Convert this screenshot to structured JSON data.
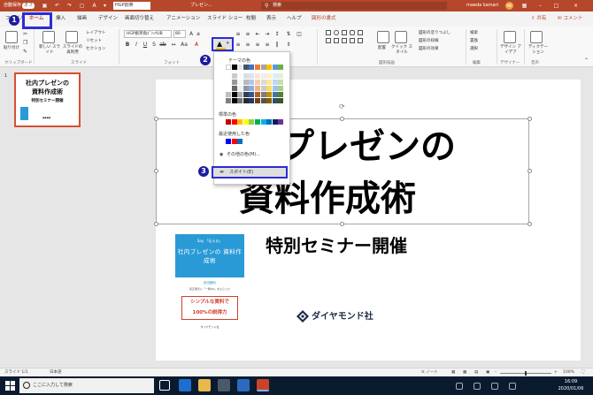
{
  "titlebar": {
    "autosave_label": "自動保存",
    "autosave_state": "オフ",
    "font_field": "HGP創英",
    "doc_title": "プレゼン...",
    "search_placeholder": "検索",
    "user_name": "maeda kamari",
    "user_initials": "MK"
  },
  "tabs": [
    {
      "label": "ファイル"
    },
    {
      "label": "ホーム",
      "active": true
    },
    {
      "label": "挿入"
    },
    {
      "label": "描画"
    },
    {
      "label": "デザイン"
    },
    {
      "label": "画面切り替え"
    },
    {
      "label": "アニメーション"
    },
    {
      "label": "スライド ショー"
    },
    {
      "label": "校閲"
    },
    {
      "label": "表示"
    },
    {
      "label": "ヘルプ"
    },
    {
      "label": "図形の書式",
      "context": true
    }
  ],
  "share_label": "共有",
  "comment_label": "コメント",
  "ribbon": {
    "paste_label": "貼り付け",
    "new_slide_label": "新しい スライド",
    "reuse_slide_label": "スライドの 再利用",
    "layout_label": "レイアウト",
    "reset_label": "リセット",
    "section_label": "セクション",
    "font_name": "HGP創英角ｺﾞｼｯｸUB",
    "font_size": "80",
    "arrange_label": "配置",
    "quick_style_label": "クイック スタイル",
    "shape_fill_label": "図形の塗りつぶし",
    "shape_outline_label": "図形の枠線",
    "shape_effect_label": "図形の効果",
    "find_label": "検索",
    "replace_label": "置換",
    "select_label": "選択",
    "designer_label": "デザイン アイデア",
    "dictate_label": "ディクテー ション",
    "groups": {
      "clipboard": "クリップボード",
      "slides": "スライド",
      "font": "フォント",
      "drawing": "図形描画",
      "editing": "編集",
      "designer": "デザイナー",
      "voice": "音声"
    }
  },
  "steps": [
    "1",
    "2",
    "3"
  ],
  "dropdown": {
    "theme_colors_label": "テーマの色",
    "standard_colors_label": "標準の色",
    "recent_colors_label": "最近使用した色",
    "other_colors_label": "その他の色(M)...",
    "eyedropper_label": "スポイト(E)",
    "theme_top_row": [
      "#ffffff",
      "#000000",
      "#e7e6e6",
      "#44546a",
      "#4472c4",
      "#ed7d31",
      "#a5a5a5",
      "#ffc000",
      "#5b9bd5",
      "#70ad47"
    ],
    "standard_colors": [
      "#c00000",
      "#ff0000",
      "#ffc000",
      "#ffff00",
      "#92d050",
      "#00b050",
      "#00b0f0",
      "#0070c0",
      "#002060",
      "#7030a0"
    ],
    "recent_colors": [
      "#0000ff",
      "#ff0000",
      "#0070c0"
    ]
  },
  "thumbnail": {
    "slide_number": "1",
    "title_line1": "社内プレゼンの",
    "title_line2": "資料作成術",
    "subtitle": "特別セミナー開催"
  },
  "slide": {
    "title_line1": "プレゼンの",
    "title_line2": "資料作成術",
    "subtitle": "特別セミナー開催",
    "publisher": "ダイヤモンド社",
    "book": {
      "top_label": "Say 「伝える」",
      "title": "社内プレゼンの 資料作成術",
      "author": "前田鎌利",
      "description": "孫正義氏に「一発OK」をもらった",
      "catch_line1": "シンプルな資料で",
      "catch_line2": "100%の説得力",
      "footer": "ダイヤモンド社"
    }
  },
  "statusbar": {
    "slide_info": "スライド 1/1",
    "language": "日本語",
    "notes_label": "ノート",
    "zoom": "100%",
    "zoom_fraction": 0.5
  },
  "taskbar": {
    "search_placeholder": "ここに入力して検索",
    "time": "16:09",
    "date": "2020/01/06"
  }
}
